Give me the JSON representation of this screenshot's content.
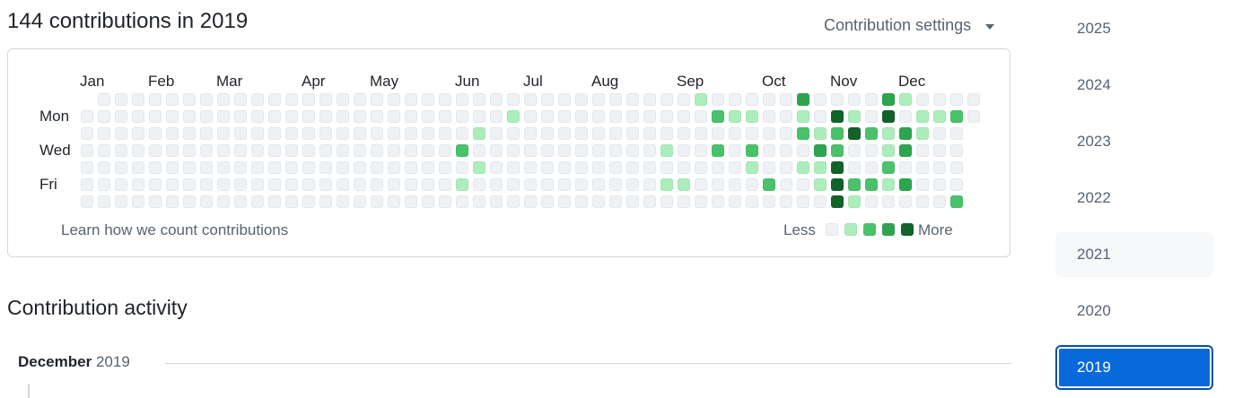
{
  "header": {
    "title": "144 contributions in 2019",
    "settings_label": "Contribution settings"
  },
  "calendar": {
    "months": [
      {
        "label": "Jan",
        "week": 0
      },
      {
        "label": "Feb",
        "week": 4
      },
      {
        "label": "Mar",
        "week": 8
      },
      {
        "label": "Apr",
        "week": 13
      },
      {
        "label": "May",
        "week": 17
      },
      {
        "label": "Jun",
        "week": 22
      },
      {
        "label": "Jul",
        "week": 26
      },
      {
        "label": "Aug",
        "week": 30
      },
      {
        "label": "Sep",
        "week": 35
      },
      {
        "label": "Oct",
        "week": 40
      },
      {
        "label": "Nov",
        "week": 44
      },
      {
        "label": "Dec",
        "week": 48
      }
    ],
    "day_labels": [
      {
        "label": "Mon",
        "row": 1
      },
      {
        "label": "Wed",
        "row": 3
      },
      {
        "label": "Fri",
        "row": 5
      }
    ],
    "first_week_start_row": 1,
    "last_week_rows": 2,
    "levels": [
      "0000000000000000000000000000000000000000000000000000",
      "0000000000000000000000000000000000000000000000000000",
      "0000000000000000000000000000000000000000000000000000",
      "0000000000000000000000000000000000000000000000000000",
      "0000000000000000000000000000000000000000000000000000",
      "0000000000000000000000000000000000000000000000000000",
      "0000000000000000000000000000000000000000000000000000"
    ],
    "cells": [
      {
        "w": 36,
        "d": 0,
        "l": 1
      },
      {
        "w": 42,
        "d": 0,
        "l": 3
      },
      {
        "w": 47,
        "d": 0,
        "l": 3
      },
      {
        "w": 48,
        "d": 0,
        "l": 1
      },
      {
        "w": 25,
        "d": 1,
        "l": 1
      },
      {
        "w": 37,
        "d": 1,
        "l": 2
      },
      {
        "w": 38,
        "d": 1,
        "l": 1
      },
      {
        "w": 39,
        "d": 1,
        "l": 1
      },
      {
        "w": 42,
        "d": 1,
        "l": 1
      },
      {
        "w": 44,
        "d": 1,
        "l": 4
      },
      {
        "w": 45,
        "d": 1,
        "l": 1
      },
      {
        "w": 47,
        "d": 1,
        "l": 4
      },
      {
        "w": 49,
        "d": 1,
        "l": 1
      },
      {
        "w": 50,
        "d": 1,
        "l": 1
      },
      {
        "w": 51,
        "d": 1,
        "l": 2
      },
      {
        "w": 23,
        "d": 2,
        "l": 1
      },
      {
        "w": 42,
        "d": 2,
        "l": 2
      },
      {
        "w": 43,
        "d": 2,
        "l": 1
      },
      {
        "w": 44,
        "d": 2,
        "l": 2
      },
      {
        "w": 45,
        "d": 2,
        "l": 4
      },
      {
        "w": 46,
        "d": 2,
        "l": 2
      },
      {
        "w": 47,
        "d": 2,
        "l": 1
      },
      {
        "w": 48,
        "d": 2,
        "l": 3
      },
      {
        "w": 49,
        "d": 2,
        "l": 1
      },
      {
        "w": 22,
        "d": 3,
        "l": 2
      },
      {
        "w": 34,
        "d": 3,
        "l": 1
      },
      {
        "w": 37,
        "d": 3,
        "l": 2
      },
      {
        "w": 39,
        "d": 3,
        "l": 2
      },
      {
        "w": 43,
        "d": 3,
        "l": 3
      },
      {
        "w": 44,
        "d": 3,
        "l": 2
      },
      {
        "w": 47,
        "d": 3,
        "l": 1
      },
      {
        "w": 48,
        "d": 3,
        "l": 3
      },
      {
        "w": 23,
        "d": 4,
        "l": 1
      },
      {
        "w": 39,
        "d": 4,
        "l": 1
      },
      {
        "w": 42,
        "d": 4,
        "l": 1
      },
      {
        "w": 43,
        "d": 4,
        "l": 1
      },
      {
        "w": 44,
        "d": 4,
        "l": 4
      },
      {
        "w": 47,
        "d": 4,
        "l": 2
      },
      {
        "w": 22,
        "d": 5,
        "l": 1
      },
      {
        "w": 34,
        "d": 5,
        "l": 1
      },
      {
        "w": 35,
        "d": 5,
        "l": 1
      },
      {
        "w": 40,
        "d": 5,
        "l": 2
      },
      {
        "w": 43,
        "d": 5,
        "l": 1
      },
      {
        "w": 44,
        "d": 5,
        "l": 4
      },
      {
        "w": 45,
        "d": 5,
        "l": 2
      },
      {
        "w": 46,
        "d": 5,
        "l": 2
      },
      {
        "w": 47,
        "d": 5,
        "l": 1
      },
      {
        "w": 48,
        "d": 5,
        "l": 3
      },
      {
        "w": 44,
        "d": 6,
        "l": 4
      },
      {
        "w": 45,
        "d": 6,
        "l": 1
      },
      {
        "w": 51,
        "d": 6,
        "l": 2
      }
    ],
    "colors": [
      "#eff2f5",
      "#aceebb",
      "#4ac26b",
      "#2da44e",
      "#116329"
    ],
    "footer_link": "Learn how we count contributions",
    "legend_less": "Less",
    "legend_more": "More"
  },
  "activity": {
    "title": "Contribution activity",
    "month": "December",
    "year": "2019"
  },
  "years": [
    "2025",
    "2024",
    "2023",
    "2022",
    "2021",
    "2020",
    "2019"
  ],
  "selected_year": "2019",
  "hovered_year": "2021"
}
